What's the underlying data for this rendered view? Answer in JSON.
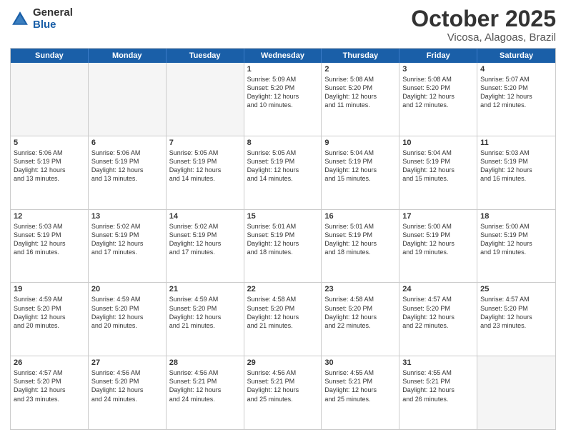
{
  "logo": {
    "general": "General",
    "blue": "Blue"
  },
  "title": {
    "month": "October 2025",
    "location": "Vicosa, Alagoas, Brazil"
  },
  "header_days": [
    "Sunday",
    "Monday",
    "Tuesday",
    "Wednesday",
    "Thursday",
    "Friday",
    "Saturday"
  ],
  "weeks": [
    [
      {
        "day": "",
        "text": "",
        "empty": true
      },
      {
        "day": "",
        "text": "",
        "empty": true
      },
      {
        "day": "",
        "text": "",
        "empty": true
      },
      {
        "day": "1",
        "text": "Sunrise: 5:09 AM\nSunset: 5:20 PM\nDaylight: 12 hours\nand 10 minutes.",
        "empty": false
      },
      {
        "day": "2",
        "text": "Sunrise: 5:08 AM\nSunset: 5:20 PM\nDaylight: 12 hours\nand 11 minutes.",
        "empty": false
      },
      {
        "day": "3",
        "text": "Sunrise: 5:08 AM\nSunset: 5:20 PM\nDaylight: 12 hours\nand 12 minutes.",
        "empty": false
      },
      {
        "day": "4",
        "text": "Sunrise: 5:07 AM\nSunset: 5:20 PM\nDaylight: 12 hours\nand 12 minutes.",
        "empty": false
      }
    ],
    [
      {
        "day": "5",
        "text": "Sunrise: 5:06 AM\nSunset: 5:19 PM\nDaylight: 12 hours\nand 13 minutes.",
        "empty": false
      },
      {
        "day": "6",
        "text": "Sunrise: 5:06 AM\nSunset: 5:19 PM\nDaylight: 12 hours\nand 13 minutes.",
        "empty": false
      },
      {
        "day": "7",
        "text": "Sunrise: 5:05 AM\nSunset: 5:19 PM\nDaylight: 12 hours\nand 14 minutes.",
        "empty": false
      },
      {
        "day": "8",
        "text": "Sunrise: 5:05 AM\nSunset: 5:19 PM\nDaylight: 12 hours\nand 14 minutes.",
        "empty": false
      },
      {
        "day": "9",
        "text": "Sunrise: 5:04 AM\nSunset: 5:19 PM\nDaylight: 12 hours\nand 15 minutes.",
        "empty": false
      },
      {
        "day": "10",
        "text": "Sunrise: 5:04 AM\nSunset: 5:19 PM\nDaylight: 12 hours\nand 15 minutes.",
        "empty": false
      },
      {
        "day": "11",
        "text": "Sunrise: 5:03 AM\nSunset: 5:19 PM\nDaylight: 12 hours\nand 16 minutes.",
        "empty": false
      }
    ],
    [
      {
        "day": "12",
        "text": "Sunrise: 5:03 AM\nSunset: 5:19 PM\nDaylight: 12 hours\nand 16 minutes.",
        "empty": false
      },
      {
        "day": "13",
        "text": "Sunrise: 5:02 AM\nSunset: 5:19 PM\nDaylight: 12 hours\nand 17 minutes.",
        "empty": false
      },
      {
        "day": "14",
        "text": "Sunrise: 5:02 AM\nSunset: 5:19 PM\nDaylight: 12 hours\nand 17 minutes.",
        "empty": false
      },
      {
        "day": "15",
        "text": "Sunrise: 5:01 AM\nSunset: 5:19 PM\nDaylight: 12 hours\nand 18 minutes.",
        "empty": false
      },
      {
        "day": "16",
        "text": "Sunrise: 5:01 AM\nSunset: 5:19 PM\nDaylight: 12 hours\nand 18 minutes.",
        "empty": false
      },
      {
        "day": "17",
        "text": "Sunrise: 5:00 AM\nSunset: 5:19 PM\nDaylight: 12 hours\nand 19 minutes.",
        "empty": false
      },
      {
        "day": "18",
        "text": "Sunrise: 5:00 AM\nSunset: 5:19 PM\nDaylight: 12 hours\nand 19 minutes.",
        "empty": false
      }
    ],
    [
      {
        "day": "19",
        "text": "Sunrise: 4:59 AM\nSunset: 5:20 PM\nDaylight: 12 hours\nand 20 minutes.",
        "empty": false
      },
      {
        "day": "20",
        "text": "Sunrise: 4:59 AM\nSunset: 5:20 PM\nDaylight: 12 hours\nand 20 minutes.",
        "empty": false
      },
      {
        "day": "21",
        "text": "Sunrise: 4:59 AM\nSunset: 5:20 PM\nDaylight: 12 hours\nand 21 minutes.",
        "empty": false
      },
      {
        "day": "22",
        "text": "Sunrise: 4:58 AM\nSunset: 5:20 PM\nDaylight: 12 hours\nand 21 minutes.",
        "empty": false
      },
      {
        "day": "23",
        "text": "Sunrise: 4:58 AM\nSunset: 5:20 PM\nDaylight: 12 hours\nand 22 minutes.",
        "empty": false
      },
      {
        "day": "24",
        "text": "Sunrise: 4:57 AM\nSunset: 5:20 PM\nDaylight: 12 hours\nand 22 minutes.",
        "empty": false
      },
      {
        "day": "25",
        "text": "Sunrise: 4:57 AM\nSunset: 5:20 PM\nDaylight: 12 hours\nand 23 minutes.",
        "empty": false
      }
    ],
    [
      {
        "day": "26",
        "text": "Sunrise: 4:57 AM\nSunset: 5:20 PM\nDaylight: 12 hours\nand 23 minutes.",
        "empty": false
      },
      {
        "day": "27",
        "text": "Sunrise: 4:56 AM\nSunset: 5:20 PM\nDaylight: 12 hours\nand 24 minutes.",
        "empty": false
      },
      {
        "day": "28",
        "text": "Sunrise: 4:56 AM\nSunset: 5:21 PM\nDaylight: 12 hours\nand 24 minutes.",
        "empty": false
      },
      {
        "day": "29",
        "text": "Sunrise: 4:56 AM\nSunset: 5:21 PM\nDaylight: 12 hours\nand 25 minutes.",
        "empty": false
      },
      {
        "day": "30",
        "text": "Sunrise: 4:55 AM\nSunset: 5:21 PM\nDaylight: 12 hours\nand 25 minutes.",
        "empty": false
      },
      {
        "day": "31",
        "text": "Sunrise: 4:55 AM\nSunset: 5:21 PM\nDaylight: 12 hours\nand 26 minutes.",
        "empty": false
      },
      {
        "day": "",
        "text": "",
        "empty": true
      }
    ]
  ]
}
